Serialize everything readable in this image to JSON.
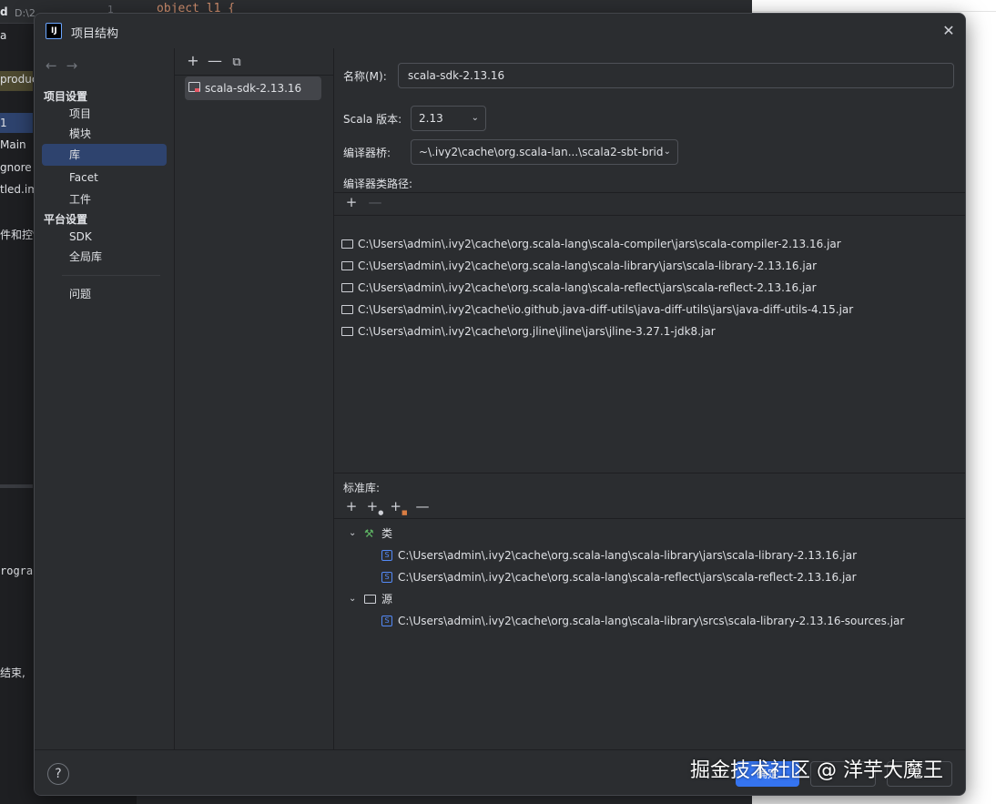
{
  "background": {
    "project_name": "d",
    "project_path": "D:\\2…",
    "code_line_number": "1",
    "code_text": "object l1 {",
    "sidebar_items": [
      "a",
      "produc",
      "1",
      "Main",
      "gnore",
      "tled.im",
      "件和控制"
    ],
    "console_text": "rogra",
    "console_text2": "结束,"
  },
  "dialog": {
    "title": "项目结构",
    "nav": {
      "section_project": "项目设置",
      "items_project": [
        "项目",
        "模块",
        "库",
        "Facet",
        "工件"
      ],
      "section_platform": "平台设置",
      "items_platform": [
        "SDK",
        "全局库"
      ],
      "problems": "问题"
    },
    "library_list": {
      "toolbar": [
        "+",
        "—",
        "⧉"
      ],
      "items": [
        "scala-sdk-2.13.16"
      ]
    },
    "details": {
      "name_label": "名称(M):",
      "name_value": "scala-sdk-2.13.16",
      "scala_version_label": "Scala 版本:",
      "scala_version_value": "2.13",
      "compiler_bridge_label": "编译器桥:",
      "compiler_bridge_value": "~\\.ivy2\\cache\\org.scala-lan...\\scala2-sbt-brid",
      "classpath_label": "编译器类路径:",
      "classpath": [
        "C:\\Users\\admin\\.ivy2\\cache\\org.scala-lang\\scala-compiler\\jars\\scala-compiler-2.13.16.jar",
        "C:\\Users\\admin\\.ivy2\\cache\\org.scala-lang\\scala-library\\jars\\scala-library-2.13.16.jar",
        "C:\\Users\\admin\\.ivy2\\cache\\org.scala-lang\\scala-reflect\\jars\\scala-reflect-2.13.16.jar",
        "C:\\Users\\admin\\.ivy2\\cache\\io.github.java-diff-utils\\java-diff-utils\\jars\\java-diff-utils-4.15.jar",
        "C:\\Users\\admin\\.ivy2\\cache\\org.jline\\jline\\jars\\jline-3.27.1-jdk8.jar"
      ],
      "stdlib_label": "标准库:",
      "classes_label": "类",
      "classes": [
        "C:\\Users\\admin\\.ivy2\\cache\\org.scala-lang\\scala-library\\jars\\scala-library-2.13.16.jar",
        "C:\\Users\\admin\\.ivy2\\cache\\org.scala-lang\\scala-reflect\\jars\\scala-reflect-2.13.16.jar"
      ],
      "sources_label": "源",
      "sources": [
        "C:\\Users\\admin\\.ivy2\\cache\\org.scala-lang\\scala-library\\srcs\\scala-library-2.13.16-sources.jar"
      ]
    },
    "footer": {
      "help": "?",
      "ok_label": "确定"
    }
  },
  "watermark": "掘金技术社区 @ 洋芋大魔王",
  "colors": {
    "accent": "#3574f0",
    "selection": "#2e436e",
    "dialog_bg": "#2b2d30",
    "ide_bg": "#1e1f22"
  }
}
